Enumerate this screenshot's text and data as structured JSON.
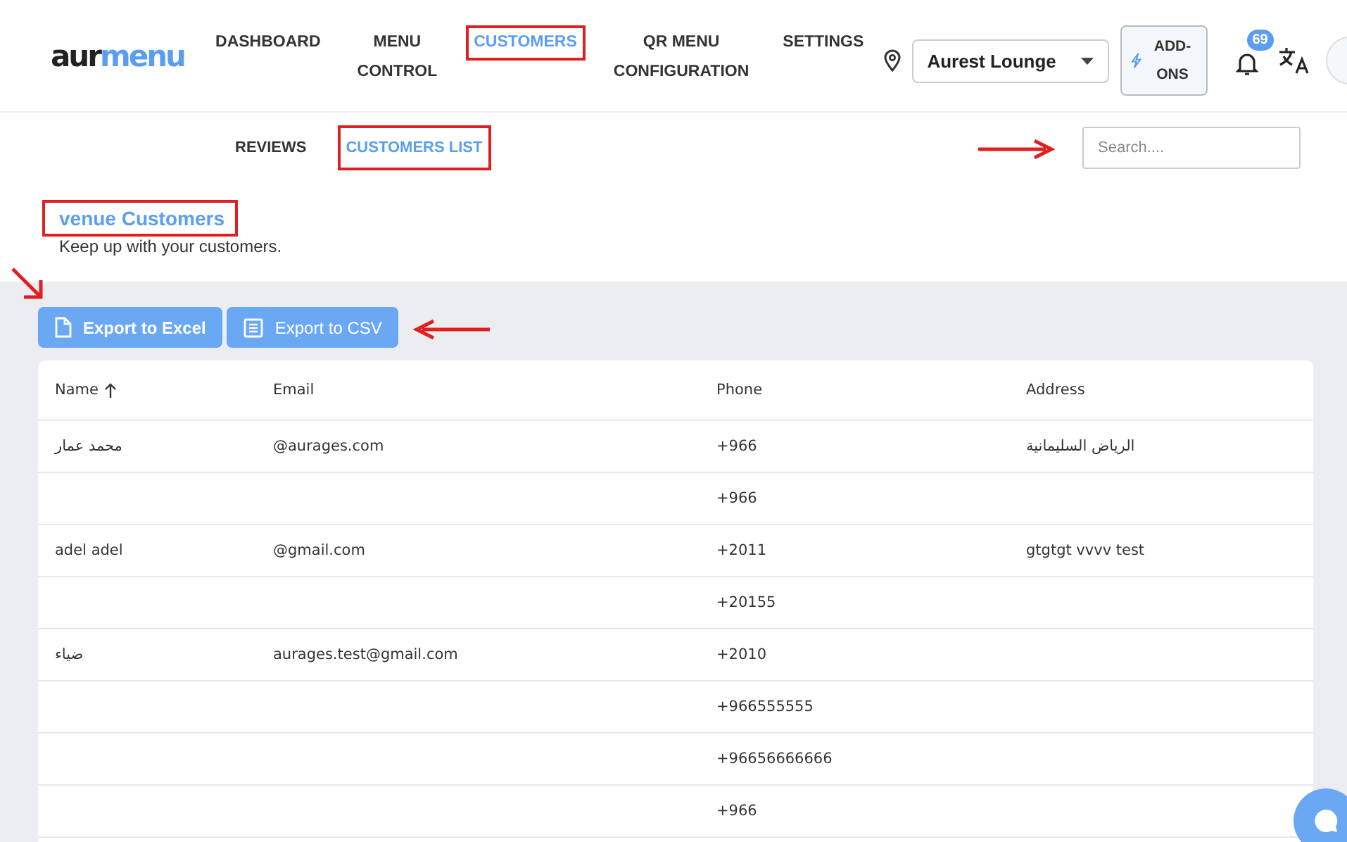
{
  "logo": {
    "part_1": "aur",
    "part_2": "menu"
  },
  "nav": [
    {
      "label": "DASHBOARD",
      "selected": false,
      "highlighted": false
    },
    {
      "label": "MENU CONTROL",
      "selected": false,
      "highlighted": false
    },
    {
      "label": "CUSTOMERS",
      "selected": true,
      "highlighted": true
    },
    {
      "label": "QR MENU CONFIGURATION",
      "selected": false,
      "highlighted": false
    },
    {
      "label": "SETTINGS",
      "selected": false,
      "highlighted": false
    }
  ],
  "venue_select": {
    "value": "Aurest Lounge"
  },
  "addons_button": "ADD-ONS",
  "notifications": {
    "count": "69"
  },
  "subnav": [
    {
      "label": "REVIEWS",
      "selected": false,
      "highlighted": false
    },
    {
      "label": "CUSTOMERS LIST",
      "selected": true,
      "highlighted": true
    }
  ],
  "search": {
    "placeholder": "Search...."
  },
  "page_title": {
    "text": "venue Customers",
    "highlighted": true
  },
  "page_subtitle": "Keep up with your customers.",
  "export_buttons": [
    {
      "kind": "excel",
      "label": "Export to Excel"
    },
    {
      "kind": "csv",
      "label": "Export to CSV"
    }
  ],
  "table": {
    "columns": [
      {
        "label": "Name",
        "sorted": true
      },
      {
        "label": "Email",
        "sorted": false
      },
      {
        "label": "Phone",
        "sorted": false
      },
      {
        "label": "Address",
        "sorted": false
      }
    ],
    "rows": [
      [
        "محمد عمار",
        "@aurages.com",
        "+966",
        "الرياض السليمانية"
      ],
      [
        "",
        "",
        "+966",
        ""
      ],
      [
        "adel adel",
        "@gmail.com",
        "+2011",
        "gtgtgt vvvv test"
      ],
      [
        "",
        "",
        "+20155",
        ""
      ],
      [
        "ضياء",
        "aurages.test@gmail.com",
        "+2010",
        ""
      ],
      [
        "",
        "",
        "+966555555",
        ""
      ],
      [
        "",
        "",
        "+96656666666",
        ""
      ],
      [
        "",
        "",
        "+966",
        ""
      ]
    ]
  }
}
